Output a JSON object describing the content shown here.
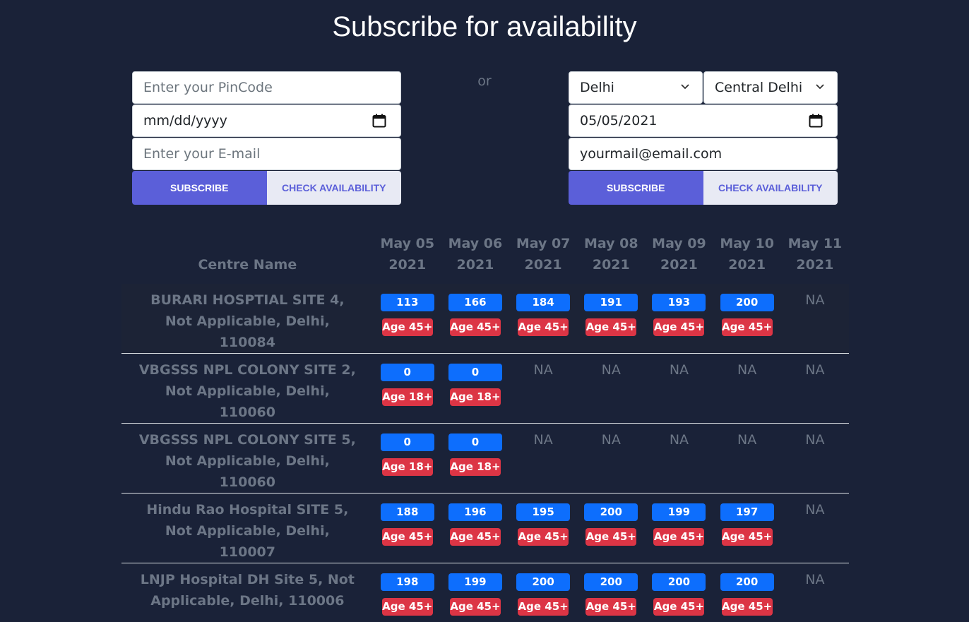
{
  "title": "Subscribe for availability",
  "separator": "or",
  "left_form": {
    "pincode_placeholder": "Enter your PinCode",
    "date_value": "mm/dd/yyyy",
    "email_placeholder": "Enter your E-mail",
    "subscribe_label": "SUBSCRIBE",
    "check_label": "CHECK AVAILABILITY"
  },
  "right_form": {
    "state_value": "Delhi",
    "district_value": "Central Delhi",
    "date_value": "05/05/2021",
    "email_value": "yourmail@email.com",
    "subscribe_label": "SUBSCRIBE",
    "check_label": "CHECK AVAILABILITY"
  },
  "colors": {
    "background": "#1a2238",
    "primary_button": "#5b5fd9",
    "capacity_badge": "#0d6efd",
    "age_badge": "#dc3545"
  },
  "table": {
    "centre_header": "Centre Name",
    "days": [
      {
        "month_day": "May 05",
        "year": "2021"
      },
      {
        "month_day": "May 06",
        "year": "2021"
      },
      {
        "month_day": "May 07",
        "year": "2021"
      },
      {
        "month_day": "May 08",
        "year": "2021"
      },
      {
        "month_day": "May 09",
        "year": "2021"
      },
      {
        "month_day": "May 10",
        "year": "2021"
      },
      {
        "month_day": "May 11",
        "year": "2021"
      }
    ],
    "rows": [
      {
        "name": "BURARI HOSPTIAL SITE 4, Not Applicable, Delhi, 110084",
        "cells": [
          {
            "capacity": "113",
            "age": "Age 45+"
          },
          {
            "capacity": "166",
            "age": "Age 45+"
          },
          {
            "capacity": "184",
            "age": "Age 45+"
          },
          {
            "capacity": "191",
            "age": "Age 45+"
          },
          {
            "capacity": "193",
            "age": "Age 45+"
          },
          {
            "capacity": "200",
            "age": "Age 45+"
          },
          {
            "na": "NA"
          }
        ]
      },
      {
        "name": "VBGSSS NPL COLONY SITE 2, Not Applicable, Delhi, 110060",
        "cells": [
          {
            "capacity": "0",
            "age": "Age 18+"
          },
          {
            "capacity": "0",
            "age": "Age 18+"
          },
          {
            "na": "NA"
          },
          {
            "na": "NA"
          },
          {
            "na": "NA"
          },
          {
            "na": "NA"
          },
          {
            "na": "NA"
          }
        ]
      },
      {
        "name": "VBGSSS NPL COLONY SITE 5, Not Applicable, Delhi, 110060",
        "cells": [
          {
            "capacity": "0",
            "age": "Age 18+"
          },
          {
            "capacity": "0",
            "age": "Age 18+"
          },
          {
            "na": "NA"
          },
          {
            "na": "NA"
          },
          {
            "na": "NA"
          },
          {
            "na": "NA"
          },
          {
            "na": "NA"
          }
        ]
      },
      {
        "name": "Hindu Rao Hospital SITE 5, Not Applicable, Delhi, 110007",
        "cells": [
          {
            "capacity": "188",
            "age": "Age 45+"
          },
          {
            "capacity": "196",
            "age": "Age 45+"
          },
          {
            "capacity": "195",
            "age": "Age 45+"
          },
          {
            "capacity": "200",
            "age": "Age 45+"
          },
          {
            "capacity": "199",
            "age": "Age 45+"
          },
          {
            "capacity": "197",
            "age": "Age 45+"
          },
          {
            "na": "NA"
          }
        ]
      },
      {
        "name": "LNJP Hospital DH Site 5, Not Applicable, Delhi, 110006",
        "cells": [
          {
            "capacity": "198",
            "age": "Age 45+"
          },
          {
            "capacity": "199",
            "age": "Age 45+"
          },
          {
            "capacity": "200",
            "age": "Age 45+"
          },
          {
            "capacity": "200",
            "age": "Age 45+"
          },
          {
            "capacity": "200",
            "age": "Age 45+"
          },
          {
            "capacity": "200",
            "age": "Age 45+"
          },
          {
            "na": "NA"
          }
        ]
      }
    ]
  }
}
